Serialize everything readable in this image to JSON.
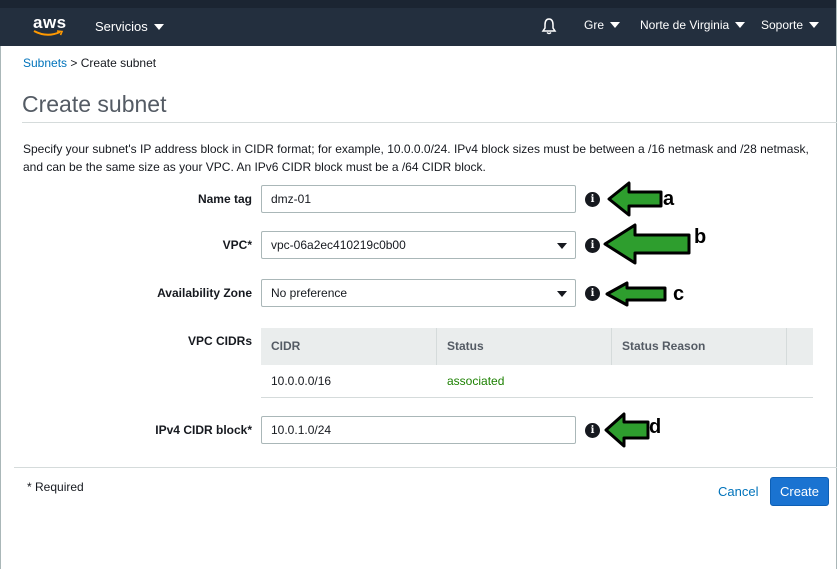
{
  "topbar": {
    "logo_text": "aws",
    "services_label": "Servicios",
    "user_label": "Gre",
    "region_label": "Norte de Virginia",
    "support_label": "Soporte"
  },
  "breadcrumb": {
    "parent": "Subnets",
    "separator": " > ",
    "current": "Create subnet"
  },
  "page_title": "Create subnet",
  "description": "Specify your subnet's IP address block in CIDR format; for example, 10.0.0.0/24. IPv4 block sizes must be between a /16 netmask and /28 netmask, and can be the same size as your VPC. An IPv6 CIDR block must be a /64 CIDR block.",
  "form": {
    "name_tag": {
      "label": "Name tag",
      "value": "dmz-01"
    },
    "vpc": {
      "label": "VPC*",
      "value": "vpc-06a2ec410219c0b00"
    },
    "availability_zone": {
      "label": "Availability Zone",
      "value": "No preference"
    },
    "vpc_cidrs": {
      "label": "VPC CIDRs",
      "columns": [
        "CIDR",
        "Status",
        "Status Reason"
      ],
      "rows": [
        {
          "cidr": "10.0.0.0/16",
          "status": "associated",
          "reason": ""
        }
      ]
    },
    "ipv4_cidr": {
      "label": "IPv4 CIDR block*",
      "value": "10.0.1.0/24"
    }
  },
  "annotations": {
    "a": "a",
    "b": "b",
    "c": "c",
    "d": "d",
    "arrow_color": "#2e9e2e"
  },
  "footer": {
    "required_note": "* Required",
    "cancel_label": "Cancel",
    "create_label": "Create"
  },
  "colors": {
    "topbar": "#232f3e",
    "link": "#0073bb",
    "primary_button": "#1a73d1",
    "status_ok": "#1d8102"
  }
}
